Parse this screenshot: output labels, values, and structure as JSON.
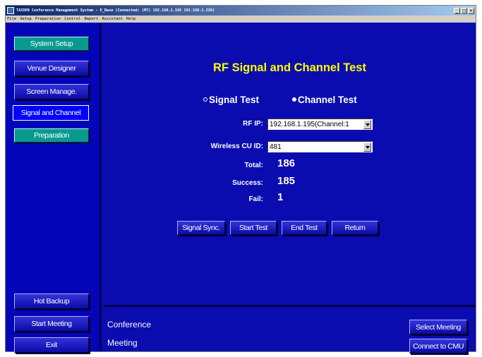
{
  "window": {
    "title": "TAIDEN Conference Management System - E_Base (Connected: (M7) 192.168.1.195 192.168.1.220)",
    "icon": "app-icon",
    "minimize": "_",
    "maximize": "□",
    "close": "×"
  },
  "menubar": [
    "File",
    "Setup",
    "Preparation",
    "Control",
    "Report",
    "Assistant",
    "Help"
  ],
  "sidebar": {
    "system_setup": "System Setup",
    "venue_designer": "Venue Designer",
    "screen_manage": "Screen Manage.",
    "signal_and_channel": "Signal and Channel",
    "preparation": "Preparation",
    "hot_backup": "Hot Backup",
    "start_meeting": "Start Meeting",
    "exit": "Exit"
  },
  "main": {
    "title": "RF Signal and Channel Test",
    "radio_signal": "Signal Test",
    "radio_channel": "Channel Test",
    "selected_mode": "Channel Test",
    "rf_ip_label": "RF IP:",
    "rf_ip_value": "192.168.1.195(Channel:1",
    "cu_id_label": "Wireless CU ID:",
    "cu_id_value": "481",
    "total_label": "Total:",
    "total_value": "186",
    "success_label": "Success:",
    "success_value": "185",
    "fail_label": "Fail:",
    "fail_value": "1",
    "buttons": {
      "signal_sync": "Signal Sync.",
      "start_test": "Start Test",
      "end_test": "End Test",
      "return": "Return"
    }
  },
  "bottom": {
    "conference": "Conference",
    "meeting": "Meeting",
    "select_meeting": "Select Meeting",
    "connect_cmu": "Connect to CMU"
  },
  "colors": {
    "background": "#0a0cb0",
    "title": "#ffff00",
    "section": "#089a8e"
  }
}
